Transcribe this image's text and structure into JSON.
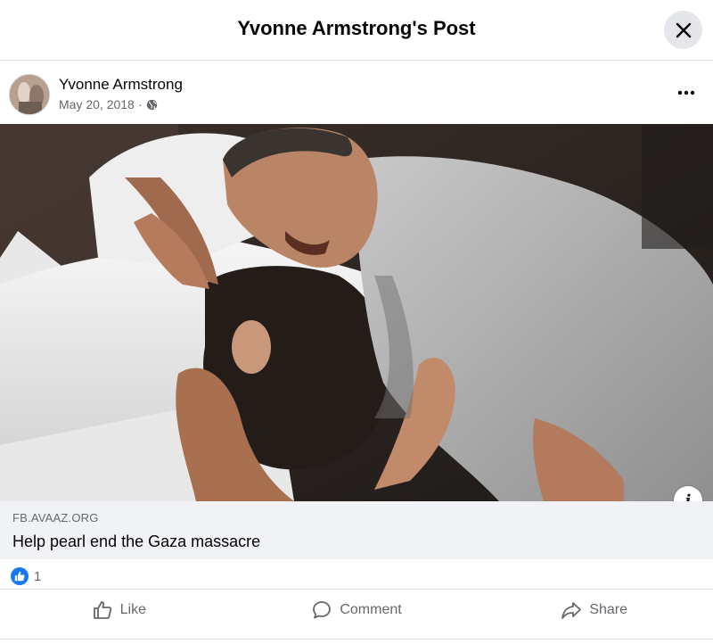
{
  "dialog": {
    "title": "Yvonne Armstrong's Post"
  },
  "post": {
    "author": "Yvonne Armstrong",
    "date": "May 20, 2018",
    "separator": "·",
    "audience_icon": "globe-icon"
  },
  "link": {
    "domain": "FB.AVAAZ.ORG",
    "title": "Help pearl end the Gaza massacre"
  },
  "reactions": {
    "type": "like",
    "count": "1"
  },
  "actions": {
    "like": "Like",
    "comment": "Comment",
    "share": "Share"
  },
  "colors": {
    "accent": "#1877f2",
    "secondary_text": "#65676b",
    "link_bg": "#f0f2f5"
  }
}
